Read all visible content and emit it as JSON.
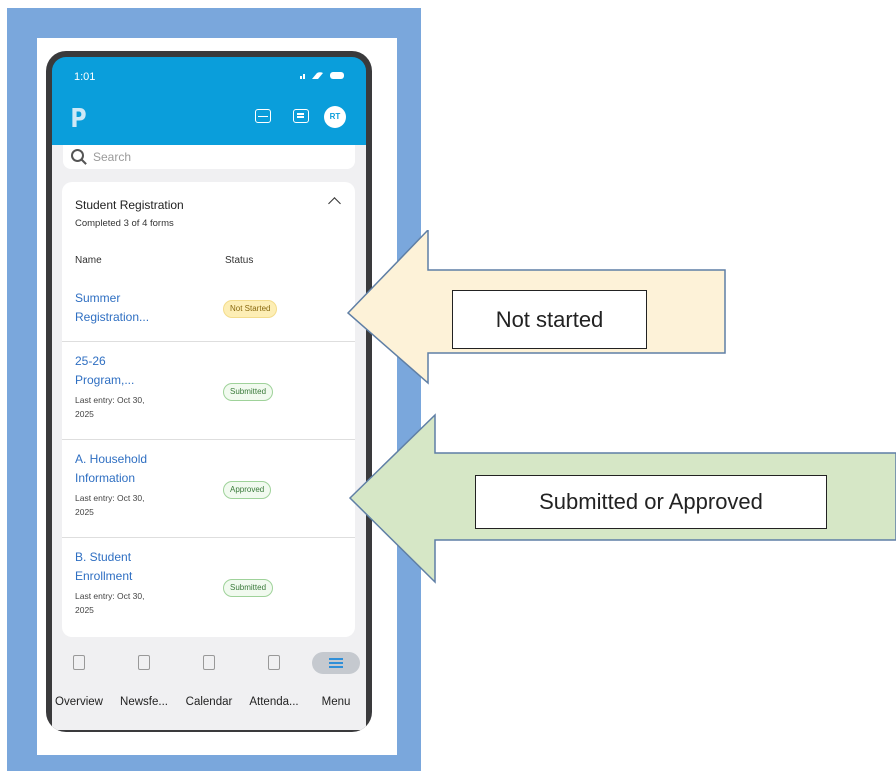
{
  "phone": {
    "status_time": "1:01",
    "status_icons": "signal-icon wifi-icon battery-icon",
    "logo": "P",
    "avatar_initials": "RT",
    "search_placeholder": "Search"
  },
  "registration": {
    "title": "Student Registration",
    "progress": "Completed 3 of 4 forms",
    "col_name": "Name",
    "col_status": "Status",
    "forms": [
      {
        "name_line1": "Summer",
        "name_line2": "Registration...",
        "last_entry_1": "",
        "last_entry_2": "",
        "status": "Not Started"
      },
      {
        "name_line1": "25-26",
        "name_line2": "Program,...",
        "last_entry_1": "Last entry: Oct 30,",
        "last_entry_2": "2025",
        "status": "Submitted"
      },
      {
        "name_line1": "A. Household",
        "name_line2": "Information",
        "last_entry_1": "Last entry: Oct 30,",
        "last_entry_2": "2025",
        "status": "Approved"
      },
      {
        "name_line1": "B. Student",
        "name_line2": "Enrollment",
        "last_entry_1": "Last entry: Oct 30,",
        "last_entry_2": "2025",
        "status": "Submitted"
      }
    ]
  },
  "nav": {
    "items": [
      {
        "label": "Overview",
        "icon": "overview-icon"
      },
      {
        "label": "Newsfe...",
        "icon": "newsfeed-icon"
      },
      {
        "label": "Calendar",
        "icon": "calendar-icon"
      },
      {
        "label": "Attenda...",
        "icon": "attendance-icon"
      },
      {
        "label": "Menu",
        "icon": "menu-icon"
      }
    ]
  },
  "callouts": {
    "not_started": "Not started",
    "submitted_approved": "Submitted or Approved"
  },
  "colors": {
    "frame": "#7aa7dc",
    "brand_blue": "#0a9edb",
    "callout_yellow": "#fdf2d8",
    "callout_green": "#d6e7c6",
    "arrow_stroke": "#5f7fa5"
  }
}
